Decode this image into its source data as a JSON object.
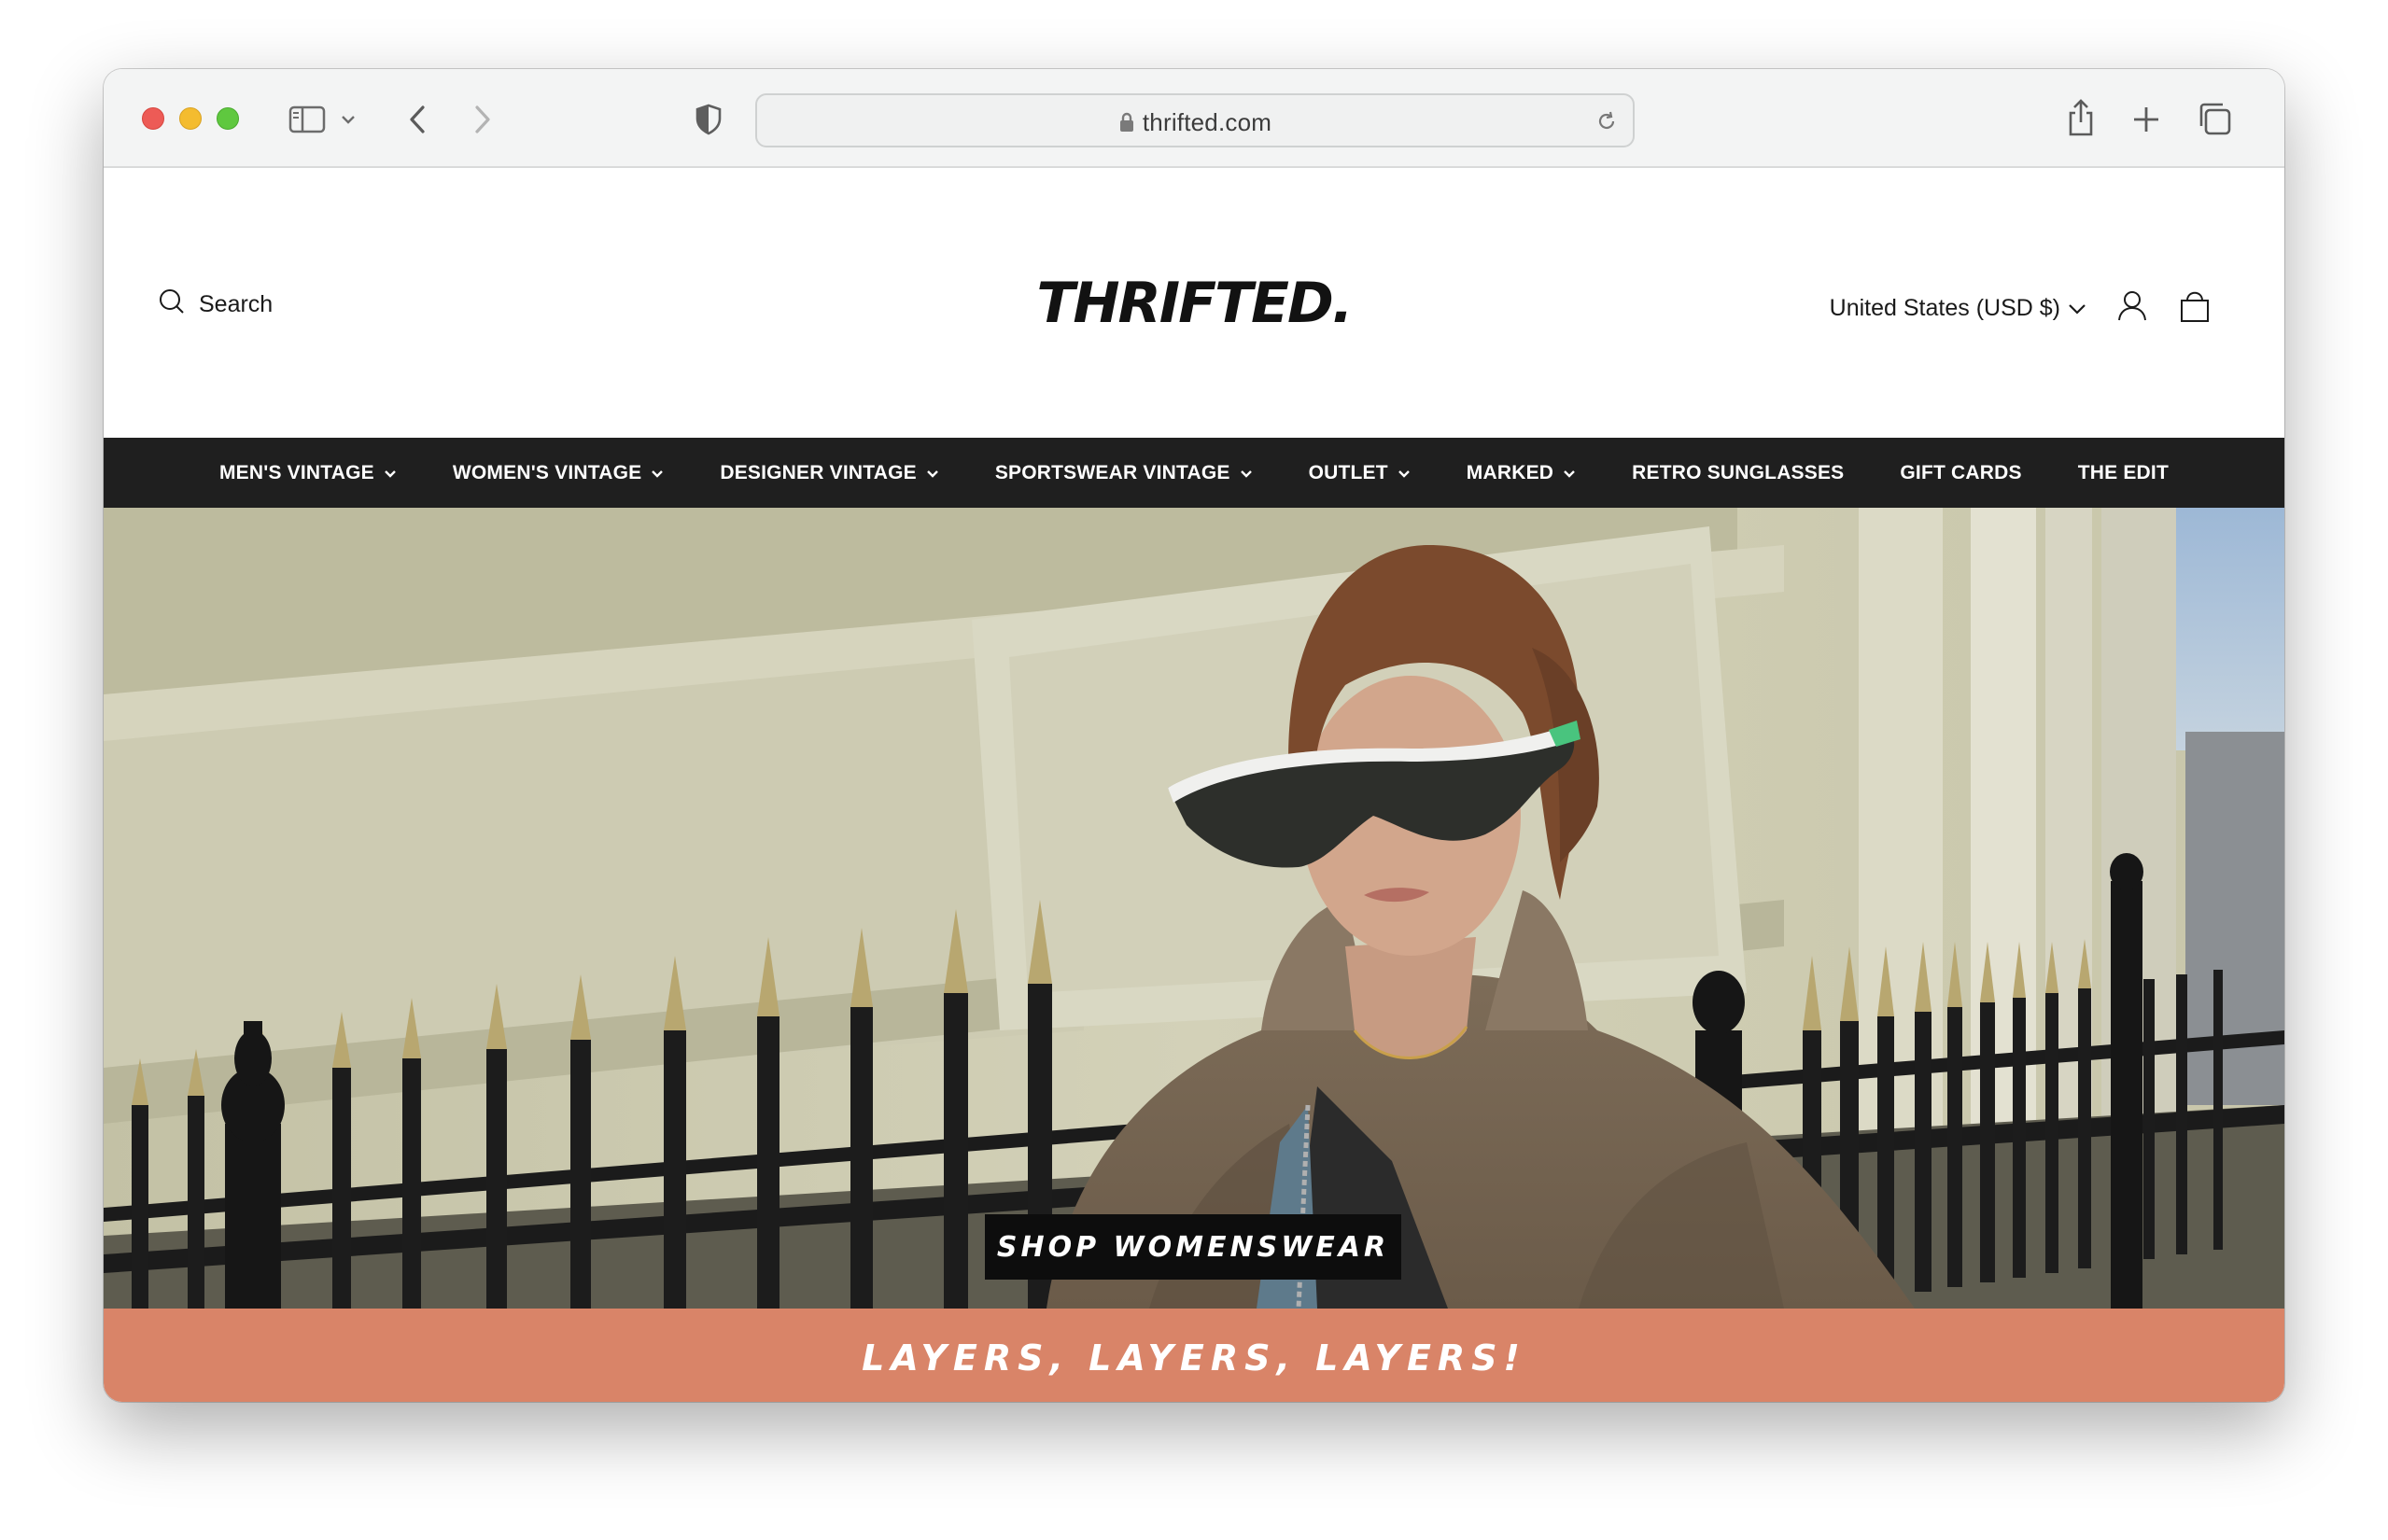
{
  "browser": {
    "url": "thrifted.com"
  },
  "header": {
    "search_label": "Search",
    "logo": "THRIFTED.",
    "country_selector": "United States (USD $)"
  },
  "nav": {
    "items": [
      {
        "label": "MEN'S VINTAGE",
        "dropdown": true
      },
      {
        "label": "WOMEN'S VINTAGE",
        "dropdown": true
      },
      {
        "label": "DESIGNER VINTAGE",
        "dropdown": true
      },
      {
        "label": "SPORTSWEAR VINTAGE",
        "dropdown": true
      },
      {
        "label": "OUTLET",
        "dropdown": true
      },
      {
        "label": "MARKED",
        "dropdown": true
      },
      {
        "label": "RETRO SUNGLASSES",
        "dropdown": false
      },
      {
        "label": "GIFT CARDS",
        "dropdown": false
      },
      {
        "label": "THE EDIT",
        "dropdown": false
      }
    ]
  },
  "hero": {
    "cta_label": "SHOP WOMENSWEAR"
  },
  "banner": {
    "text": "LAYERS, LAYERS, LAYERS!"
  },
  "colors": {
    "nav_background": "#1f1f1f",
    "banner_background": "#d98468",
    "cta_background": "#0d0d0d"
  }
}
